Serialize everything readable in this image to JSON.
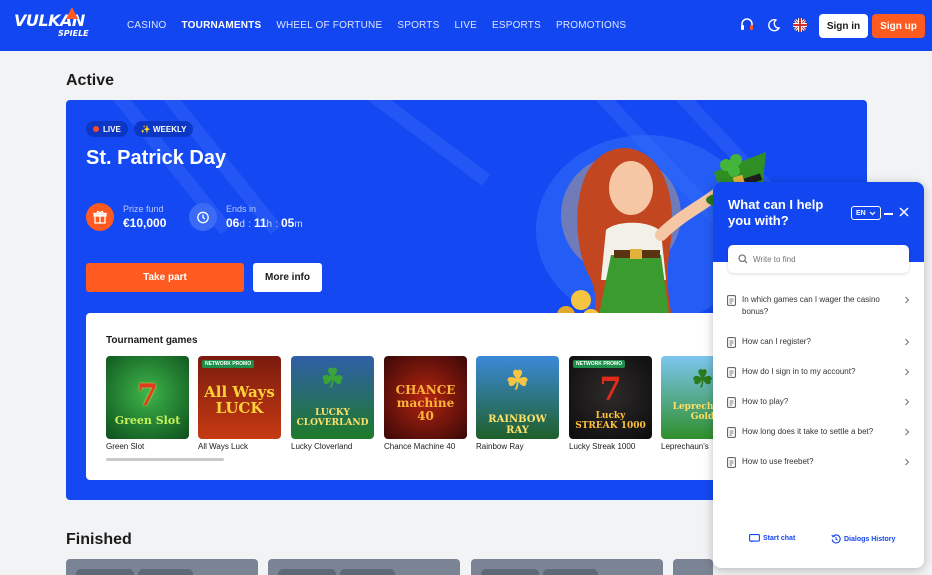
{
  "header": {
    "logo_main": "VULKAN",
    "logo_sub": "SPIELE",
    "nav": [
      {
        "label": "CASINO",
        "active": false
      },
      {
        "label": "TOURNAMENTS",
        "active": true
      },
      {
        "label": "WHEEL OF FORTUNE",
        "active": false
      },
      {
        "label": "SPORTS",
        "active": false
      },
      {
        "label": "LIVE",
        "active": false
      },
      {
        "label": "ESPORTS",
        "active": false
      },
      {
        "label": "PROMOTIONS",
        "active": false
      }
    ],
    "icons": [
      "support-icon",
      "moon-icon",
      "uk-flag-icon"
    ],
    "signin_label": "Sign in",
    "signup_label": "Sign up",
    "colors": {
      "bar": "#1246f0",
      "accent": "#ff5a1f"
    }
  },
  "active": {
    "section_title": "Active",
    "badges": {
      "live": "LIVE",
      "weekly": "✨ WEEKLY"
    },
    "title": "St. Patrick Day",
    "prize": {
      "label": "Prize fund",
      "value": "€10,000"
    },
    "ends": {
      "label": "Ends in",
      "days": "06",
      "days_unit": "d",
      "hours": "11",
      "hours_unit": "h",
      "minutes": "05",
      "minutes_unit": "m"
    },
    "take_part_label": "Take part",
    "more_info_label": "More info",
    "games_title": "Tournament games",
    "games": [
      {
        "name": "Green Slot",
        "thumb_text": "Green Slot",
        "promo": ""
      },
      {
        "name": "All Ways Luck",
        "thumb_text": "All Ways LUCK",
        "promo": "NETWORK PROMO"
      },
      {
        "name": "Lucky Cloverland",
        "thumb_text": "LUCKY CLOVERLAND",
        "promo": ""
      },
      {
        "name": "Chance Machine 40",
        "thumb_text": "CHANCE machine 40",
        "promo": ""
      },
      {
        "name": "Rainbow Ray",
        "thumb_text": "RAINBOW RAY",
        "promo": ""
      },
      {
        "name": "Lucky Streak 1000",
        "thumb_text": "Lucky STREAK 1000",
        "promo": "NETWORK PROMO"
      },
      {
        "name": "Leprechaun's",
        "thumb_text": "Leprechaun Gold",
        "promo": ""
      }
    ]
  },
  "finished": {
    "section_title": "Finished"
  },
  "chat": {
    "title": "What can I help you with?",
    "lang": "EN",
    "search_placeholder": "Write to find",
    "faqs": [
      "In which games can I wager the casino bonus?",
      "How can I register?",
      "How do I sign in to my account?",
      "How to play?",
      "How long does it take to settle a bet?",
      "How to use freebet?"
    ],
    "start_chat_label": "Start chat",
    "history_label": "Dialogs History"
  }
}
